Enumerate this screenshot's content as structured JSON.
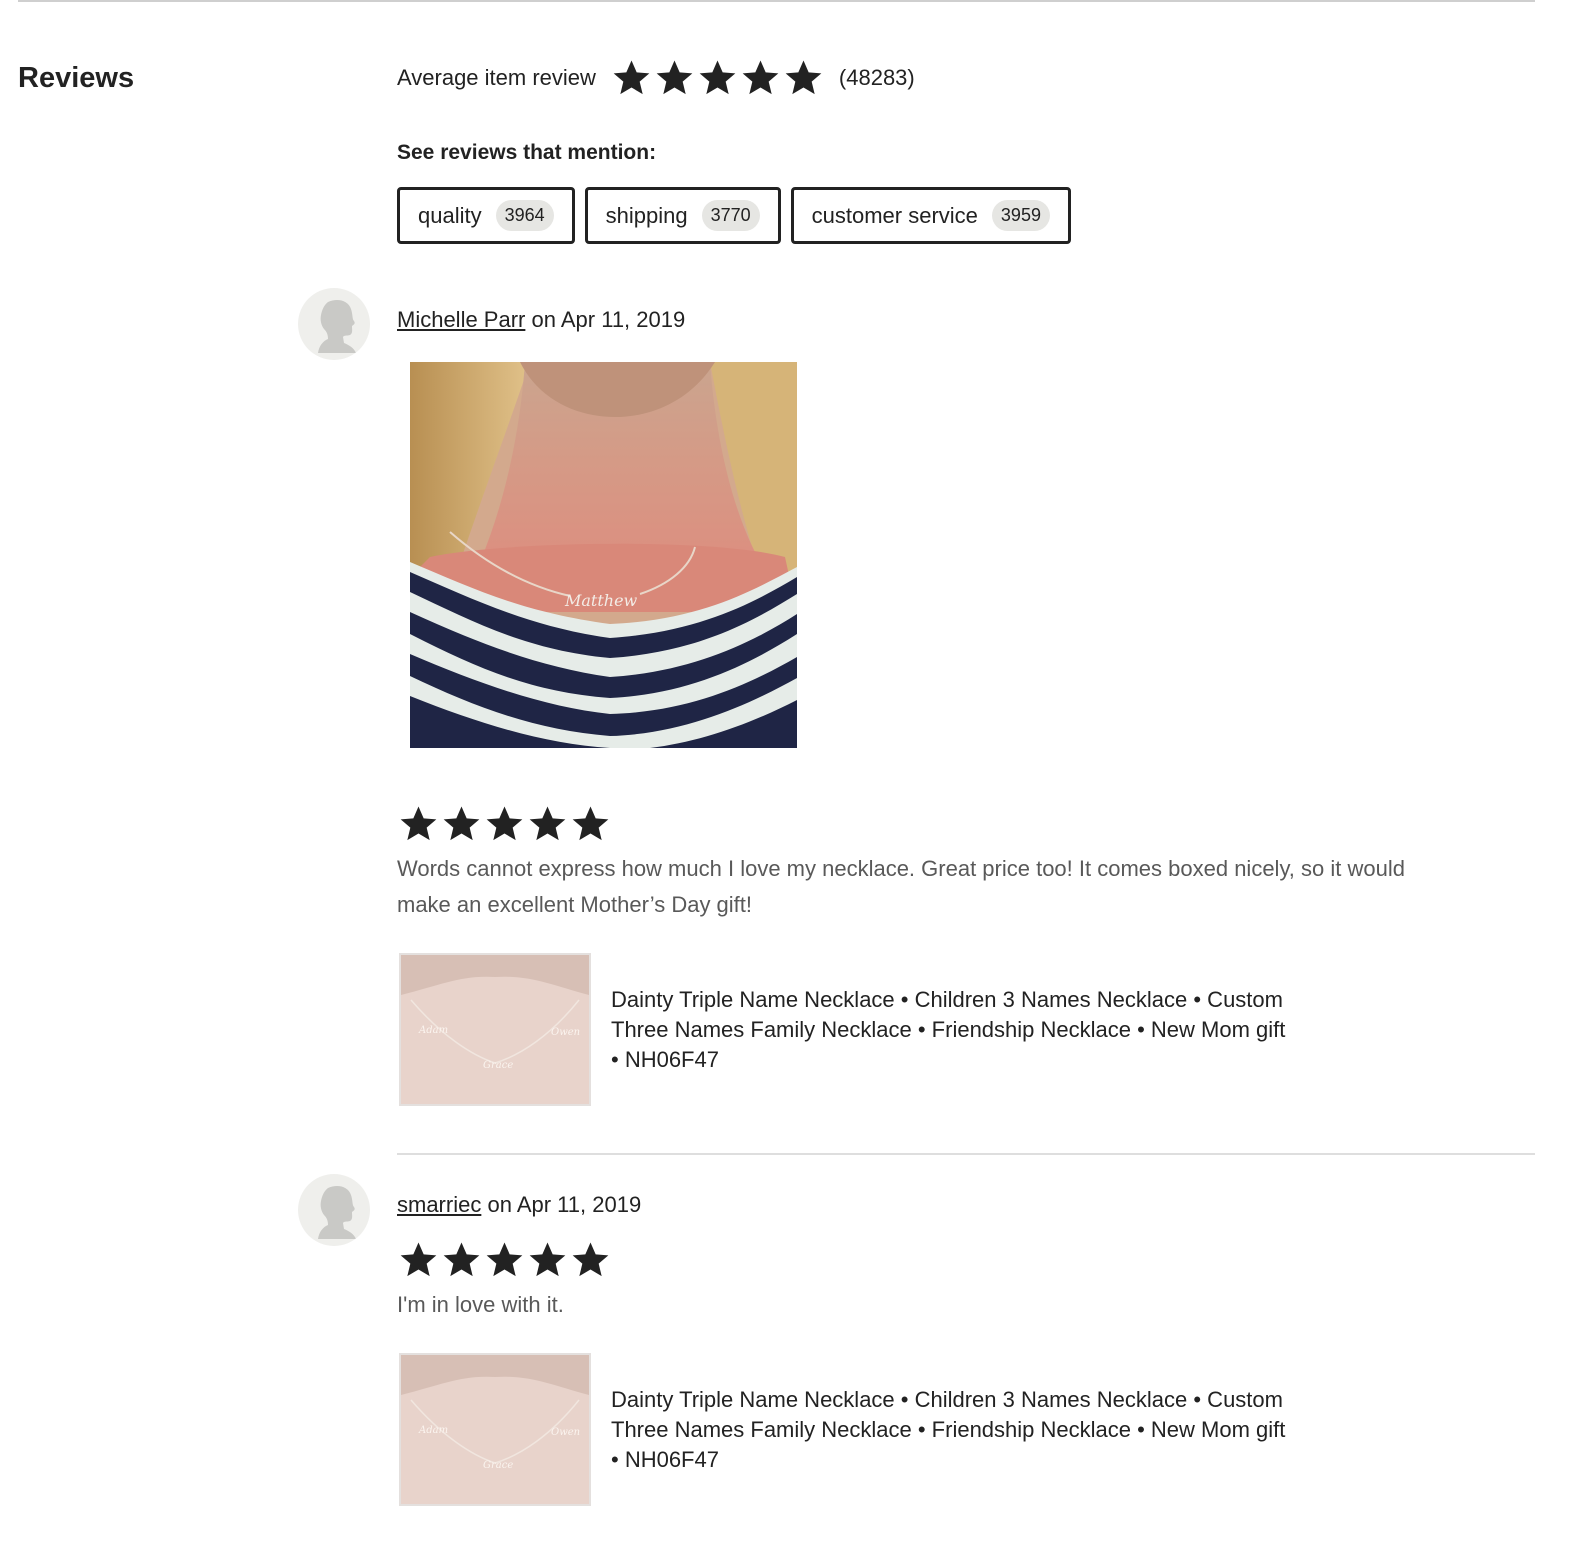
{
  "section": {
    "title": "Reviews"
  },
  "summary": {
    "label": "Average item review",
    "rating": 5,
    "count_text": "(48283)",
    "star_icon": "star-icon"
  },
  "mentions": {
    "title": "See reviews that mention:",
    "chips": [
      {
        "label": "quality",
        "count": "3964"
      },
      {
        "label": "shipping",
        "count": "3770"
      },
      {
        "label": "customer service",
        "count": "3959"
      }
    ]
  },
  "reviews": [
    {
      "reviewer": "Michelle Parr",
      "date_text": "on Apr 11, 2019",
      "rating": 5,
      "text": "Words cannot express how much I love my necklace. Great price too! It comes boxed nicely, so it would make an excellent Mother’s Day gift!",
      "photo_text": "Matthew",
      "item_title": "Dainty Triple Name Necklace • Children 3 Names Necklace • Custom Three Names Family Necklace • Friendship Necklace • New Mom gift • NH06F47"
    },
    {
      "reviewer": "smarriec",
      "date_text": "on Apr 11, 2019",
      "rating": 5,
      "text": "I'm in love with it.",
      "item_title": "Dainty Triple Name Necklace • Children 3 Names Necklace • Custom Three Names Family Necklace • Friendship Necklace • New Mom gift • NH06F47"
    }
  ],
  "colors": {
    "text": "#222222",
    "muted_text": "#595959",
    "chip_badge": "#e6e6e3",
    "avatar_bg": "#efefec",
    "divider": "#dedede"
  }
}
